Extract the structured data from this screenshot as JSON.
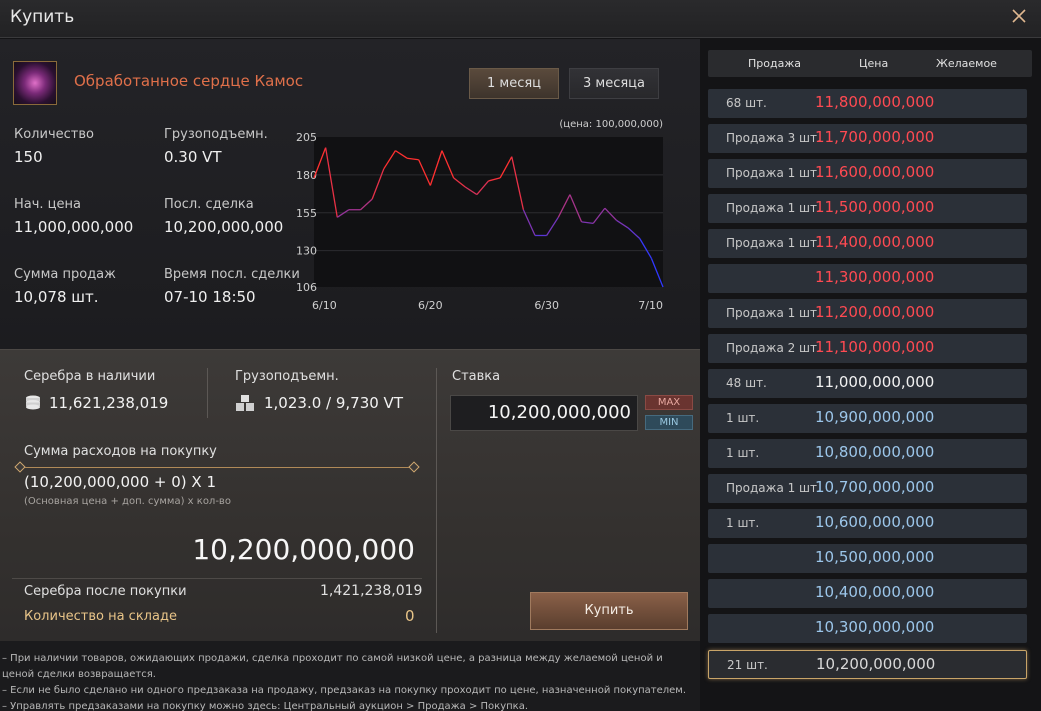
{
  "window": {
    "title": "Купить"
  },
  "item": {
    "name": "Обработанное сердце Камос"
  },
  "periods": {
    "one_month": "1 месяц",
    "three_months": "3 месяца"
  },
  "stats": [
    {
      "label": "Количество",
      "value": "150"
    },
    {
      "label": "Грузоподъемн.",
      "value": "0.30 VT"
    },
    {
      "label": "Нач. цена",
      "value": "11,000,000,000"
    },
    {
      "label": "Посл. сделка",
      "value": "10,200,000,000"
    },
    {
      "label": "Сумма продаж",
      "value": "10,078 шт."
    },
    {
      "label": "Время посл. сделки",
      "value": "07-10 18:50"
    }
  ],
  "chart_data": {
    "type": "line",
    "unit_label": "(цена: 100,000,000)",
    "y_ticks": [
      "205",
      "180",
      "155",
      "130",
      "106"
    ],
    "ylim": [
      106,
      205
    ],
    "x_ticks": [
      "6/10",
      "6/20",
      "6/30",
      "7/10"
    ],
    "x_range": [
      0,
      30
    ],
    "series": [
      {
        "x": [
          0,
          1,
          2,
          3,
          4,
          5,
          6,
          7,
          8,
          9,
          10,
          11,
          12,
          13,
          14,
          15,
          16,
          17,
          18,
          19,
          20,
          21,
          22,
          23,
          24,
          25,
          26,
          27,
          28,
          29,
          30
        ],
        "values": [
          178,
          198,
          152,
          157,
          157,
          164,
          184,
          196,
          191,
          190,
          173,
          196,
          178,
          172,
          167,
          176,
          178,
          192,
          157,
          140,
          140,
          152,
          167,
          149,
          148,
          158,
          150,
          145,
          138,
          125,
          106
        ]
      }
    ],
    "colors": {
      "high": "#ff3030",
      "low": "#3038ff"
    }
  },
  "buy": {
    "silver_label": "Серебра в наличии",
    "silver_value": "11,621,238,019",
    "weight_label": "Грузоподъемн.",
    "weight_value": "1,023.0 / 9,730 VT",
    "bid_label": "Ставка",
    "bid_value": "10,200,000,000",
    "max_label": "MAX",
    "min_label": "MIN",
    "cost_label": "Сумма расходов на покупку",
    "formula": "(10,200,000,000 + 0) X 1",
    "formula_hint": "(Основная цена + доп. сумма) х кол-во",
    "total": "10,200,000,000",
    "after_label": "Серебра после покупки",
    "after_value": "1,421,238,019",
    "stock_label": "Количество на складе",
    "stock_value": "0",
    "buy_button": "Купить"
  },
  "notes": [
    "– При наличии товаров, ожидающих продажи, сделка проходит по самой низкой цене, а разница между желаемой ценой и",
    "  ценой сделки возвращается.",
    "– Если не было сделано ни одного предзаказа на продажу, предзаказ на покупку проходит по цене, назначенной покупателем.",
    "– Управлять предзаказами на покупку можно здесь: Центральный аукцион > Продажа > Покупка."
  ],
  "orderbook": {
    "headers": {
      "sell": "Продажа",
      "price": "Цена",
      "desired": "Желаемое"
    },
    "rows": [
      {
        "qty": "68 шт.",
        "price": "11,800,000,000",
        "color": "red"
      },
      {
        "qty": "Продажа 3 шт.",
        "price": "11,700,000,000",
        "color": "red"
      },
      {
        "qty": "Продажа 1 шт.",
        "price": "11,600,000,000",
        "color": "red"
      },
      {
        "qty": "Продажа 1 шт.",
        "price": "11,500,000,000",
        "color": "red"
      },
      {
        "qty": "Продажа 1 шт.",
        "price": "11,400,000,000",
        "color": "red"
      },
      {
        "qty": "",
        "price": "11,300,000,000",
        "color": "red"
      },
      {
        "qty": "Продажа 1 шт.",
        "price": "11,200,000,000",
        "color": "red"
      },
      {
        "qty": "Продажа 2 шт.",
        "price": "11,100,000,000",
        "color": "red"
      },
      {
        "qty": "48 шт.",
        "price": "11,000,000,000",
        "color": "white"
      },
      {
        "qty": "1 шт.",
        "price": "10,900,000,000",
        "color": "blue"
      },
      {
        "qty": "1 шт.",
        "price": "10,800,000,000",
        "color": "blue"
      },
      {
        "qty": "Продажа 1 шт.",
        "price": "10,700,000,000",
        "color": "blue"
      },
      {
        "qty": "1 шт.",
        "price": "10,600,000,000",
        "color": "blue"
      },
      {
        "qty": "",
        "price": "10,500,000,000",
        "color": "blue"
      },
      {
        "qty": "",
        "price": "10,400,000,000",
        "color": "blue"
      },
      {
        "qty": "",
        "price": "10,300,000,000",
        "color": "blue"
      },
      {
        "qty": "21 шт.",
        "price": "10,200,000,000",
        "color": "sel-c",
        "selected": true
      }
    ]
  }
}
